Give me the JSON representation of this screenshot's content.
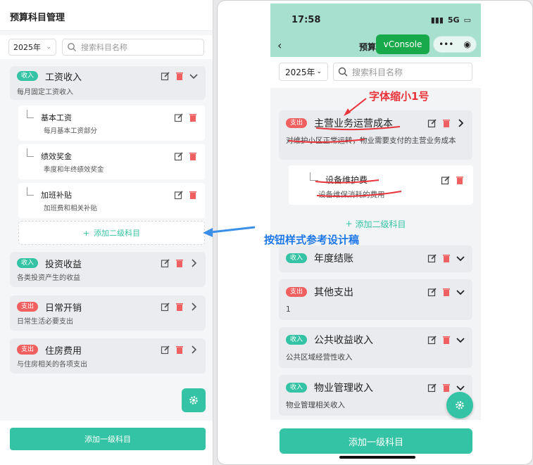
{
  "left": {
    "title": "预算科目管理",
    "year": "2025年",
    "search_placeholder": "搜索科目名称",
    "categories": [
      {
        "badge": "收入",
        "name": "工资收入",
        "desc": "每月固定工资收入"
      },
      {
        "badge": "收入",
        "name": "投资收益",
        "desc": "各类投资产生的收益"
      },
      {
        "badge": "支出",
        "name": "日常开销",
        "desc": "日常生活必要支出"
      },
      {
        "badge": "支出",
        "name": "住房费用",
        "desc": "与住房相关的各项支出"
      }
    ],
    "subitems": [
      {
        "name": "基本工资",
        "desc": "每月基本工资部分"
      },
      {
        "name": "绩效奖金",
        "desc": "季度和年终绩效奖金"
      },
      {
        "name": "加班补贴",
        "desc": "加班费和相关补贴"
      }
    ],
    "add_sub_label": "添加二级科目",
    "add_top_label": "添加一级科目"
  },
  "phone": {
    "time": "17:58",
    "network": "5G",
    "nav_title": "预算",
    "vconsole_label": "vConsole",
    "year": "2025年",
    "search_placeholder": "搜索科目名称",
    "categories": [
      {
        "badge": "支出",
        "name": "主营业务运营成本",
        "desc": "对维护小区正常运转，物业需要支付的主营业务成本"
      },
      {
        "badge": "收入",
        "name": "年度结账",
        "desc": ""
      },
      {
        "badge": "支出",
        "name": "其他支出",
        "desc": "1"
      },
      {
        "badge": "收入",
        "name": "公共收益收入",
        "desc": "公共区域经营性收入"
      },
      {
        "badge": "收入",
        "name": "物业管理收入",
        "desc": "物业管理相关收入"
      }
    ],
    "subitem": {
      "name": "设备维护费",
      "desc": "设备维保消耗的费用"
    },
    "add_sub_label": "添加二级科目",
    "add_top_label": "添加一级科目"
  },
  "annotations": {
    "font_note": "字体缩小1号",
    "button_note": "按钮样式参考设计稿"
  },
  "colors": {
    "accent": "#34c3a4",
    "income": "#34c3a4",
    "expense": "#f06060",
    "annotation_blue": "#1e78e8",
    "annotation_red": "#e8333a"
  }
}
